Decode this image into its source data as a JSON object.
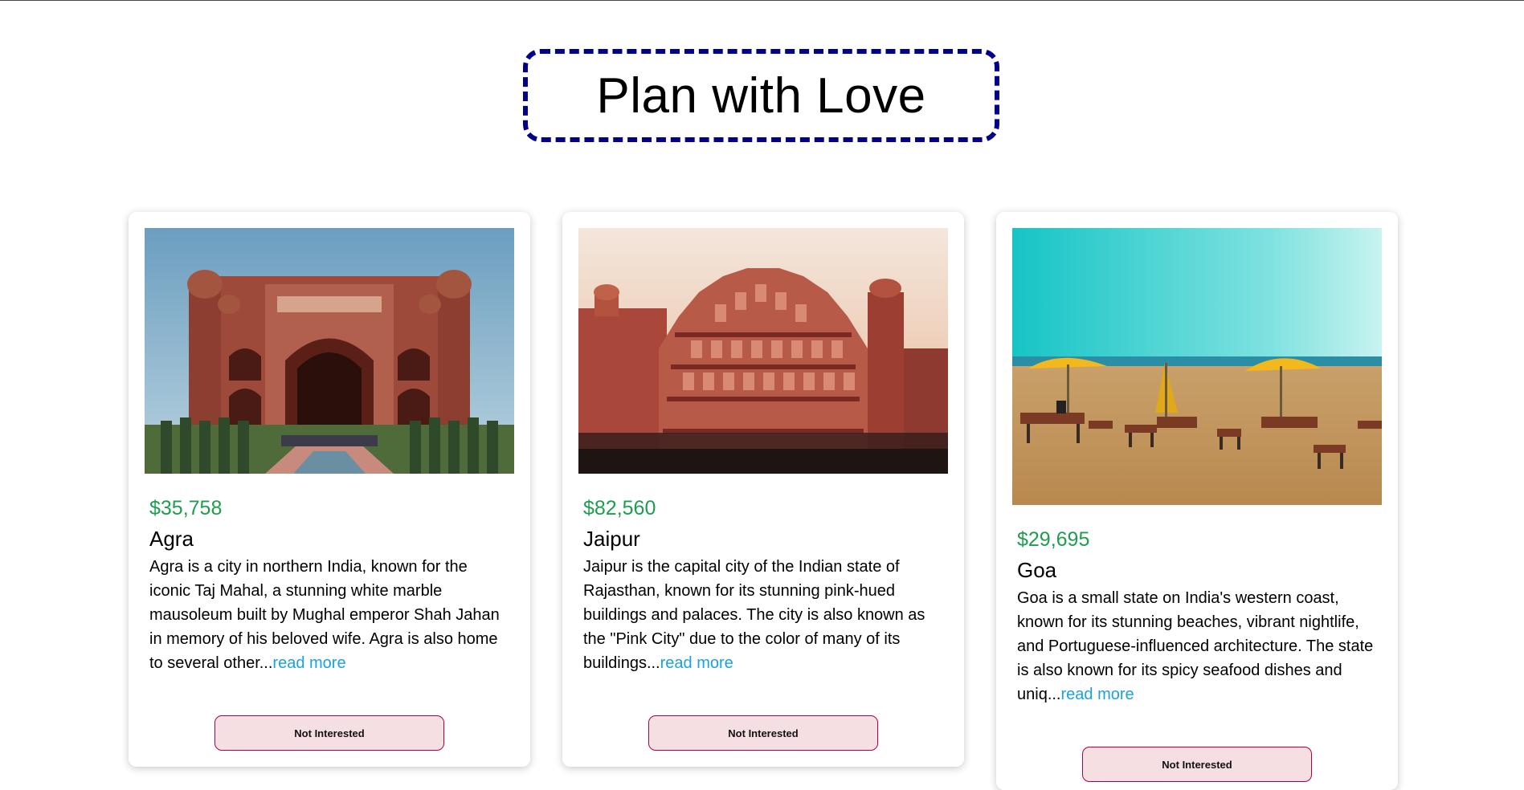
{
  "header": {
    "title": "Plan with Love",
    "border_color": "#00008b"
  },
  "tours": [
    {
      "price": "$35,758",
      "name": "Agra",
      "description": "Agra is a city in northern India, known for the iconic Taj Mahal, a stunning white marble mausoleum built by Mughal emperor Shah Jahan in memory of his beloved wife. Agra is also home to several other...",
      "read_more": "read more",
      "button": "Not Interested",
      "image": "fort-gate-photo"
    },
    {
      "price": "$82,560",
      "name": "Jaipur",
      "description": "Jaipur is the capital city of the Indian state of Rajasthan, known for its stunning pink-hued buildings and palaces. The city is also known as the \"Pink City\" due to the color of many of its buildings...",
      "read_more": "read more",
      "button": "Not Interested",
      "image": "palace-facade-photo"
    },
    {
      "price": "$29,695",
      "name": "Goa",
      "description": "Goa is a small state on India's western coast, known for its stunning beaches, vibrant nightlife, and Portuguese-influenced architecture. The state is also known for its spicy seafood dishes and uniq...",
      "read_more": "read more",
      "button": "Not Interested",
      "image": "beach-photo"
    }
  ],
  "colors": {
    "price": "#1f9d4f",
    "link": "#1aa3d9",
    "button_bg": "#f5dfe3",
    "button_border": "#b00046"
  }
}
